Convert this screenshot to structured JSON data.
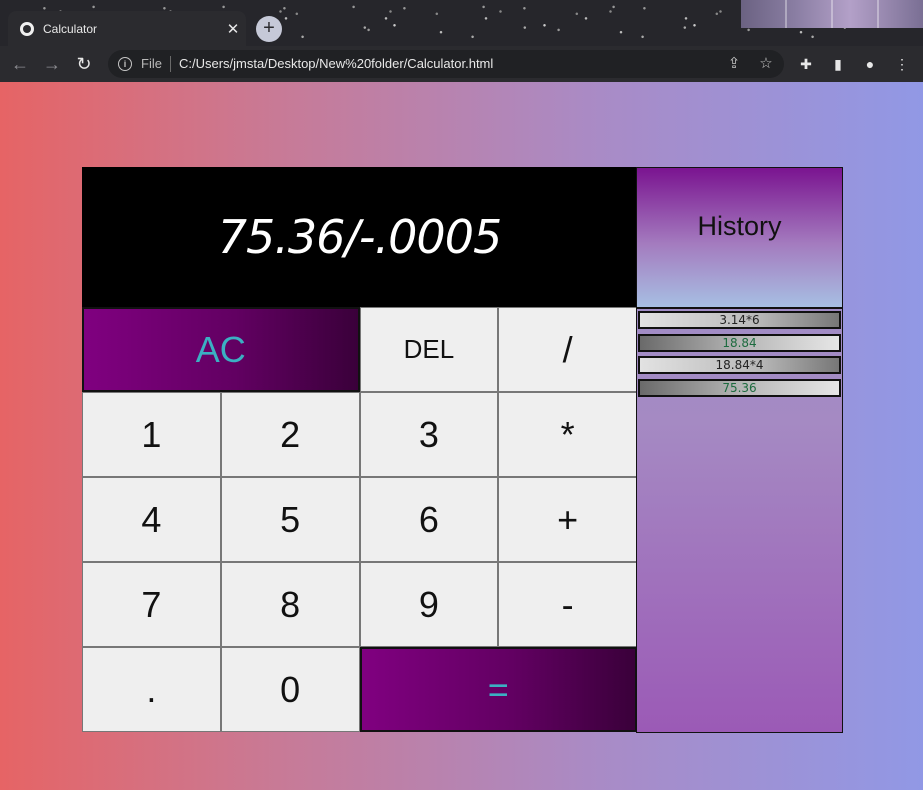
{
  "browser": {
    "tab_title": "Calculator",
    "tab_close": "✕",
    "new_tab": "+",
    "back": "←",
    "forward": "→",
    "reload": "↻",
    "scheme_label": "File",
    "url": "C:/Users/jmsta/Desktop/New%20folder/Calculator.html",
    "info_icon": "i",
    "share_icon": "⇪",
    "star_icon": "☆",
    "extensions_icon": "✚",
    "sidepanel_icon": "▮",
    "profile_icon": "●",
    "menu_icon": "⋮"
  },
  "calculator": {
    "display": "75.36/-.0005",
    "keys": {
      "ac": "AC",
      "del": "DEL",
      "divide": "/",
      "one": "1",
      "two": "2",
      "three": "3",
      "multiply": "*",
      "four": "4",
      "five": "5",
      "six": "6",
      "plus": "+",
      "seven": "7",
      "eight": "8",
      "nine": "9",
      "minus": "-",
      "dot": ".",
      "zero": "0",
      "equals": "="
    }
  },
  "history": {
    "title": "History",
    "items": [
      "3.14*6",
      "18.84",
      "18.84*4",
      "75.36"
    ]
  },
  "colors": {
    "bg_start": "#e66465",
    "bg_end": "#9198e5",
    "accent_purple": "#800080",
    "accent_text": "#3bb0c3",
    "result_text": "#1d6b3f"
  }
}
